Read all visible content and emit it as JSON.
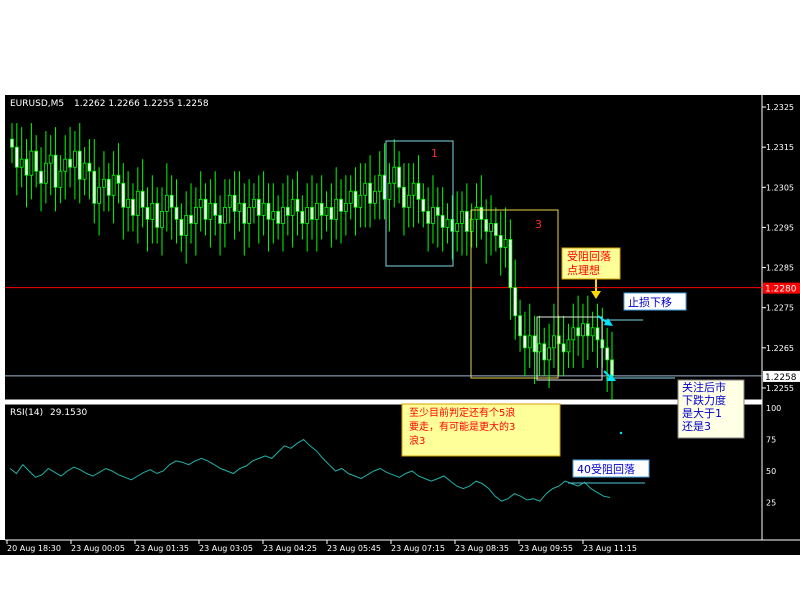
{
  "chart_data": {
    "type": "candlestick",
    "symbol": "EURUSD,M5",
    "header_values": "1.2262 1.2266 1.2255 1.2258",
    "ylim": [
      1.2252,
      1.2328
    ],
    "price_ticks": [
      "1.2325",
      "1.2315",
      "1.2305",
      "1.2295",
      "1.2285",
      "1.2275",
      "1.2265",
      "1.2255"
    ],
    "current_price": "1.2258",
    "red_level": "1.2280",
    "x_ticks": [
      "20 Aug 18:30",
      "23 Aug 00:05",
      "23 Aug 01:35",
      "23 Aug 03:05",
      "23 Aug 04:25",
      "23 Aug 05:45",
      "23 Aug 07:15",
      "23 Aug 08:35",
      "23 Aug 09:55",
      "23 Aug 11:15"
    ],
    "closes": [
      1.2315,
      1.231,
      1.2312,
      1.2308,
      1.2314,
      1.2309,
      1.2306,
      1.2311,
      1.2313,
      1.2305,
      1.2309,
      1.2312,
      1.231,
      1.2314,
      1.2307,
      1.2311,
      1.2309,
      1.2301,
      1.2305,
      1.2307,
      1.2303,
      1.2308,
      1.2306,
      1.23,
      1.2302,
      1.2298,
      1.2304,
      1.23,
      1.2297,
      1.2301,
      1.2295,
      1.2299,
      1.2303,
      1.23,
      1.2297,
      1.2293,
      1.2298,
      1.2296,
      1.23,
      1.2302,
      1.2297,
      1.2301,
      1.2298,
      1.2296,
      1.23,
      1.2303,
      1.2299,
      1.2301,
      1.2296,
      1.23,
      1.2302,
      1.2298,
      1.2301,
      1.2297,
      1.2299,
      1.2296,
      1.23,
      1.2298,
      1.2302,
      1.2299,
      1.2296,
      1.23,
      1.2297,
      1.2301,
      1.2298,
      1.23,
      1.2297,
      1.2302,
      1.2299,
      1.2301,
      1.2304,
      1.23,
      1.2303,
      1.2306,
      1.2301,
      1.2304,
      1.2308,
      1.2302,
      1.2306,
      1.231,
      1.2305,
      1.23,
      1.2303,
      1.2306,
      1.2302,
      1.2299,
      1.2296,
      1.23,
      1.2298,
      1.2295,
      1.2297,
      1.2294,
      1.2296,
      1.2299,
      1.2294,
      1.2297,
      1.23,
      1.2297,
      1.2294,
      1.2296,
      1.2293,
      1.229,
      1.2292,
      1.228,
      1.2273,
      1.2268,
      1.2265,
      1.2268,
      1.2264,
      1.2266,
      1.2262,
      1.2265,
      1.2268,
      1.2266,
      1.2264,
      1.2267,
      1.227,
      1.2268,
      1.2271,
      1.2268,
      1.227,
      1.2267,
      1.2265,
      1.2262,
      1.2258
    ],
    "rsi": {
      "label": "RSI(14)",
      "value": "29.1530",
      "levels": [
        "100",
        "75",
        "50",
        "25",
        "0"
      ],
      "values": [
        52,
        48,
        55,
        50,
        45,
        47,
        52,
        49,
        46,
        50,
        53,
        51,
        48,
        46,
        49,
        52,
        50,
        47,
        45,
        43,
        46,
        49,
        51,
        48,
        50,
        55,
        58,
        57,
        55,
        58,
        60,
        58,
        55,
        52,
        50,
        48,
        52,
        54,
        58,
        60,
        62,
        60,
        65,
        70,
        68,
        72,
        75,
        70,
        66,
        60,
        55,
        50,
        52,
        48,
        46,
        44,
        47,
        50,
        52,
        49,
        47,
        45,
        48,
        50,
        46,
        44,
        42,
        44,
        46,
        42,
        38,
        36,
        38,
        42,
        40,
        36,
        30,
        26,
        28,
        32,
        30,
        27,
        28,
        26,
        32,
        36,
        38,
        42,
        40,
        38,
        41,
        36,
        33,
        30,
        29
      ]
    },
    "annotations": [
      {
        "id": "box1_label",
        "text": "1"
      },
      {
        "id": "box3_label",
        "text": "3"
      },
      {
        "id": "note_resist",
        "lines": [
          "受阻回落",
          "点理想"
        ]
      },
      {
        "id": "note_stop",
        "text": "止损下移"
      },
      {
        "id": "note_follow",
        "lines": [
          "关注后市",
          "下跌力度",
          "是大于1",
          "还是3"
        ]
      },
      {
        "id": "note_wave",
        "lines": [
          "至少目前判定还有个5浪",
          "要走，有可能是更大的3",
          "浪3"
        ]
      },
      {
        "id": "note_rsi",
        "text": "40受阻回落"
      }
    ],
    "colors": {
      "candle": "#00ff00",
      "red_line": "#ff0000",
      "price_line": "#9fb8d0",
      "box_cyan": "#7fd7e8",
      "box_yellow": "#e8d24a",
      "rsi_line": "#20b2aa",
      "note_text_red": "#ff0000",
      "note_text_blue": "#0000cc"
    }
  }
}
